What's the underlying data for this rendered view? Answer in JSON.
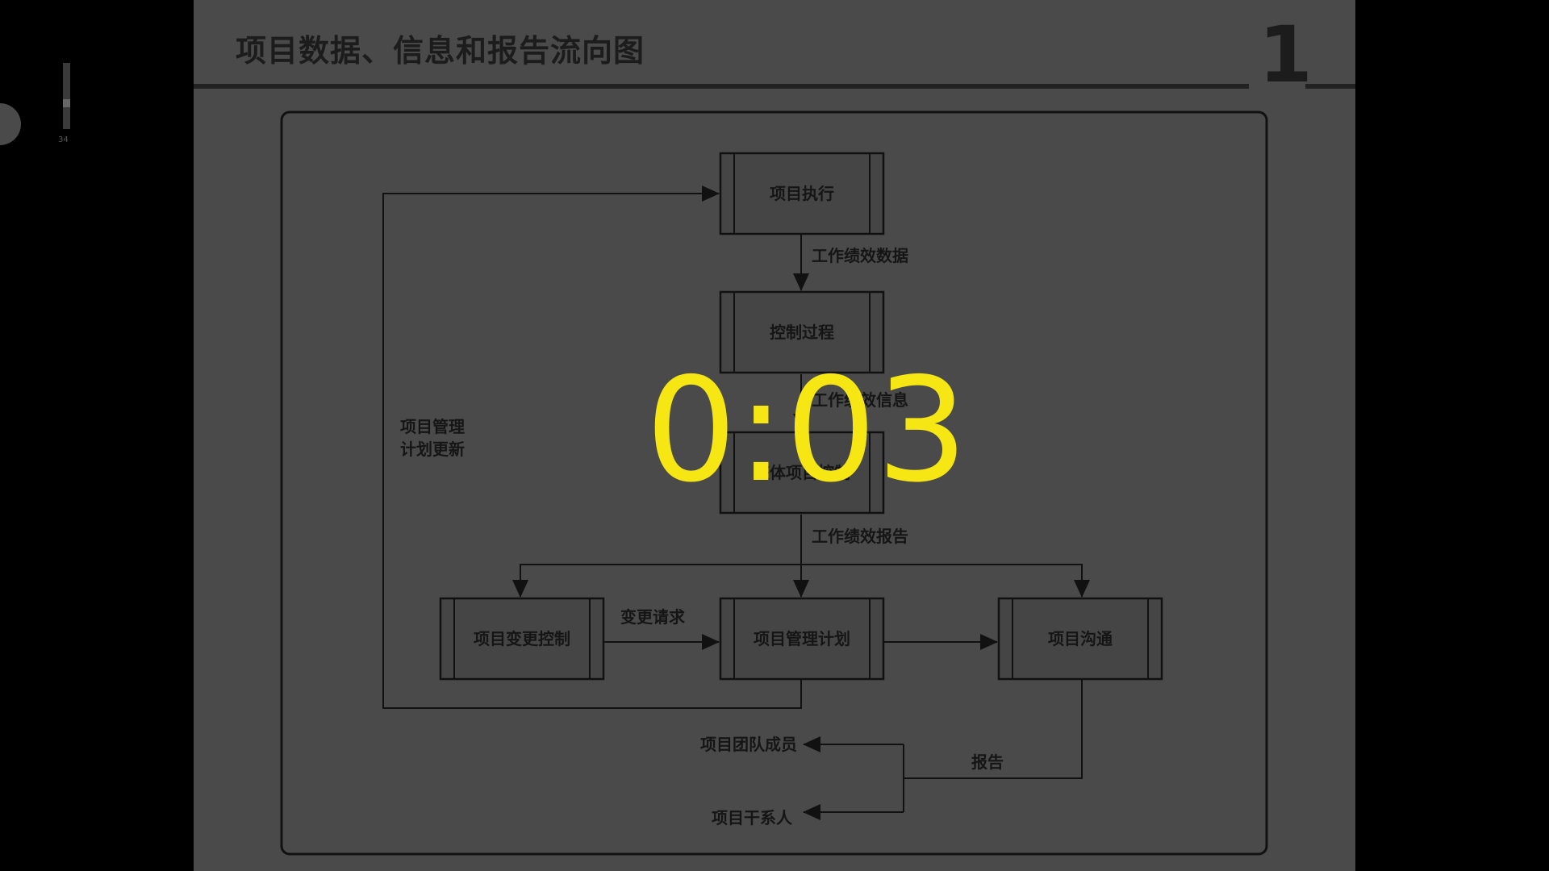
{
  "player": {
    "volume_label": "34",
    "timer": "0:03"
  },
  "slide": {
    "title": "项目数据、信息和报告流向图",
    "page_number": "1",
    "diagram": {
      "boxes": {
        "execute": "项目执行",
        "control": "控制过程",
        "integrated": "整体项目控制",
        "change": "项目变更控制",
        "plan": "项目管理计划",
        "comm": "项目沟通"
      },
      "labels": {
        "perf_data": "工作绩效数据",
        "perf_info": "工作绩效信息",
        "perf_report": "工作绩效报告",
        "change_request": "变更请求",
        "plan_update_1": "项目管理",
        "plan_update_2": "计划更新",
        "report": "报告",
        "team": "项目团队成员",
        "stakeholders": "项目干系人"
      }
    }
  }
}
